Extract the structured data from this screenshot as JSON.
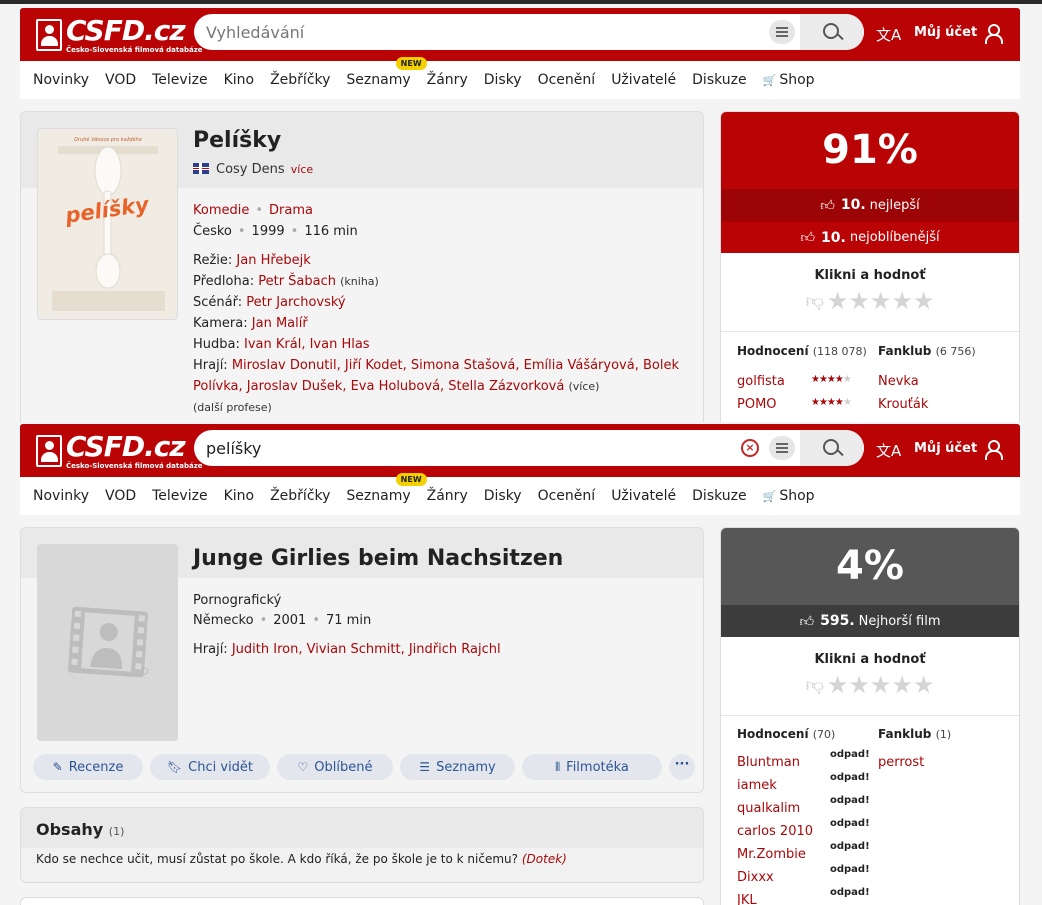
{
  "shot1": {
    "header": {
      "logo_text": "CSFD.cz",
      "logo_sub": "Česko-Slovenská filmová databáze",
      "search_placeholder": "Vyhledávání",
      "search_value": "",
      "lang_icon": "文A",
      "account": "Můj účet"
    },
    "nav": [
      "Novinky",
      "VOD",
      "Televize",
      "Kino",
      "Žebříčky",
      "Seznamy",
      "Žánry",
      "Disky",
      "Ocenění",
      "Uživatelé",
      "Diskuze",
      "Shop"
    ],
    "nav_badge": "NEW",
    "film": {
      "poster_tagline": "Druhé Vánoce pro každého",
      "poster_title": "pelíšky",
      "title": "Pelíšky",
      "alt_title": "Cosy Dens",
      "alt_more": "více",
      "genres": [
        "Komedie",
        "Drama"
      ],
      "country": "Česko",
      "year": "1999",
      "length": "116 min",
      "rezie_label": "Režie:",
      "rezie": "Jan Hřebejk",
      "predloha_label": "Předloha:",
      "predloha": "Petr Šabach",
      "predloha_note": "(kniha)",
      "scenar_label": "Scénář:",
      "scenar": "Petr Jarchovský",
      "kamera_label": "Kamera:",
      "kamera": "Jan Malíř",
      "hudba_label": "Hudba:",
      "hudba": "Ivan Král, Ivan Hlas",
      "hraji_label": "Hrají:",
      "hraji_line1": "Miroslav Donutil, Jiří Kodet, Simona Stašová, Emília Vášáryová, Bolek",
      "hraji_line2": "Polívka, Jaroslav Dušek, Eva Holubová, Stella Zázvorková",
      "hraji_more": "(více)",
      "dalsi": "(další profese)"
    },
    "rating": {
      "percent": "91%",
      "rank1_num": "10.",
      "rank1_label": "nejlepší",
      "rank2_num": "10.",
      "rank2_label": "nejoblíbenější",
      "klikni": "Klikni a hodnoť",
      "hodnoceni_label": "Hodnocení",
      "hodnoceni_count": "(118 078)",
      "fanklub_label": "Fanklub",
      "fanklub_count": "(6 756)",
      "users": [
        {
          "name": "golfista",
          "stars": 4
        },
        {
          "name": "POMO",
          "stars": 4
        }
      ],
      "fans": [
        "Nevka",
        "Krouťák"
      ],
      "color_top": "#ba0305",
      "color_rank": "#9c0406"
    }
  },
  "shot2": {
    "header": {
      "logo_text": "CSFD.cz",
      "logo_sub": "Česko-Slovenská filmová databáze",
      "search_placeholder": "Vyhledávání",
      "search_value": "pelíšky",
      "lang_icon": "文A",
      "account": "Můj účet"
    },
    "nav": [
      "Novinky",
      "VOD",
      "Televize",
      "Kino",
      "Žebříčky",
      "Seznamy",
      "Žánry",
      "Disky",
      "Ocenění",
      "Uživatelé",
      "Diskuze",
      "Shop"
    ],
    "nav_badge": "NEW",
    "film": {
      "title": "Junge Girlies beim Nachsitzen",
      "genre": "Pornografický",
      "country": "Německo",
      "year": "2001",
      "length": "71 min",
      "hraji_label": "Hrají:",
      "hraji": "Judith Iron, Vivian Schmitt, Jindřich Rajchl",
      "actions": [
        "Recenze",
        "Chci vidět",
        "Oblíbené",
        "Seznamy",
        "Filmotéka"
      ],
      "action_more": "···"
    },
    "rating": {
      "percent": "4%",
      "rank_num": "595.",
      "rank_label": "Nejhorší film",
      "klikni": "Klikni a hodnoť",
      "hodnoceni_label": "Hodnocení",
      "hodnoceni_count": "(70)",
      "fanklub_label": "Fanklub",
      "fanklub_count": "(1)",
      "odpad": "odpad!",
      "users": [
        "Bluntman",
        "iamek",
        "qualkalim",
        "carlos 2010",
        "Mr.Zombie",
        "Dixxx",
        "JKL"
      ],
      "fans": [
        "perrost"
      ],
      "color_top": "#575757",
      "color_rank": "#3c3c3c"
    },
    "obsahy": {
      "title": "Obsahy",
      "count": "(1)",
      "text": "Kdo se nechce učit, musí zůstat po škole. A kdo říká, že po škole je to k ničemu?",
      "author": "(Dotek)"
    }
  }
}
